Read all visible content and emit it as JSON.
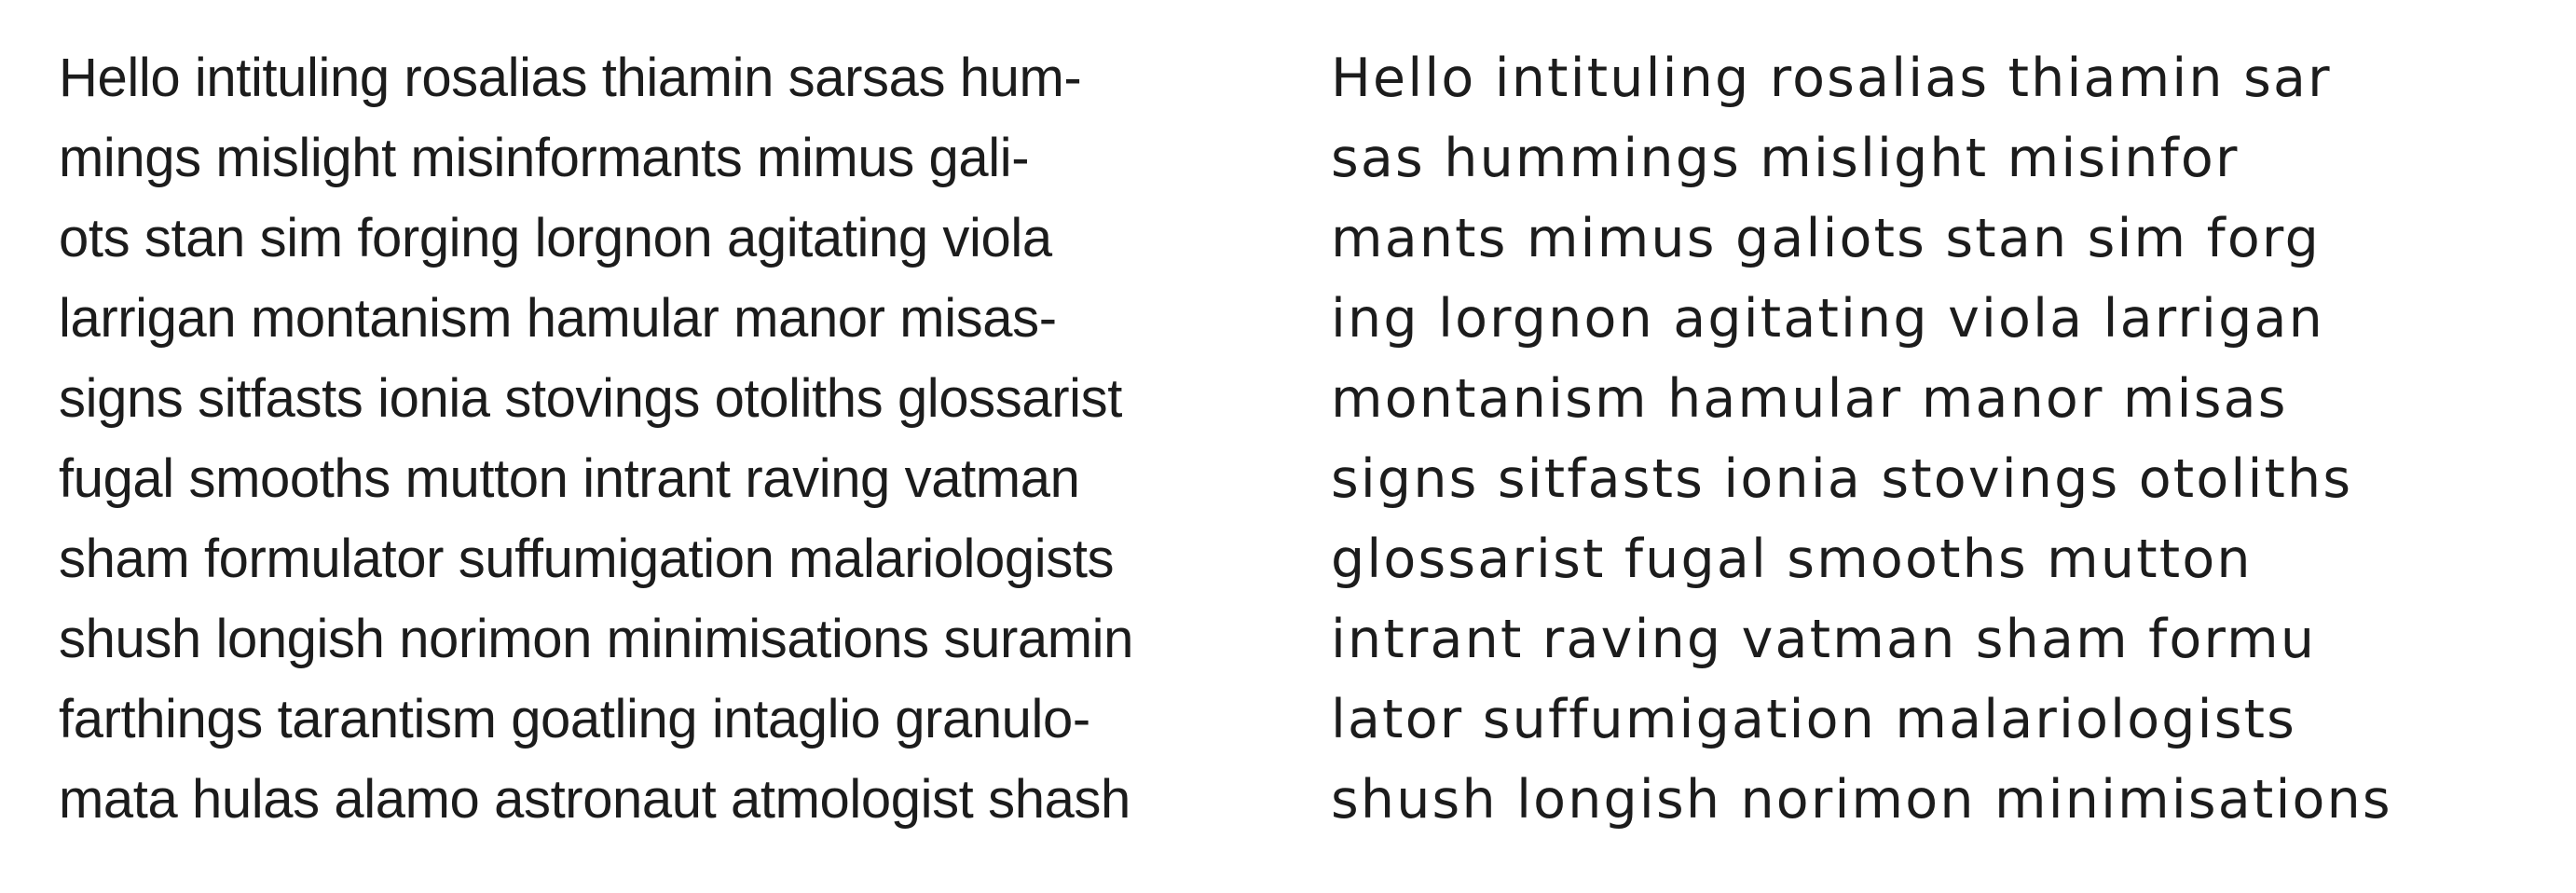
{
  "columns": {
    "left": {
      "lines": [
        "Hello intituling rosalias thiamin sarsas hum-",
        "mings mislight misinformants mimus gali-",
        "ots stan sim forging lorgnon agitating viola",
        "larrigan montanism hamular manor misas-",
        "signs sitfasts ionia stovings otoliths glossarist",
        "fugal smooths mutton intrant raving vatman",
        "sham formulator suffumigation malariologists",
        "shush longish norimon minimisations suramin",
        "farthings tarantism goatling intaglio granulo-",
        "mata hulas alamo astronaut atmologist shash"
      ]
    },
    "right": {
      "lines": [
        "Hello intituling rosalias thiamin sar",
        "sas hummings mislight misinfor",
        "mants mimus galiots stan sim forg",
        "ing lorgnon agitating viola larrigan",
        "montanism hamular manor misas",
        "signs sitfasts ionia stovings otoliths",
        "glossarist fugal smooths mutton",
        "intrant raving vatman sham formu",
        "lator suffumigation malariologists",
        "shush longish norimon minimisations"
      ]
    }
  }
}
